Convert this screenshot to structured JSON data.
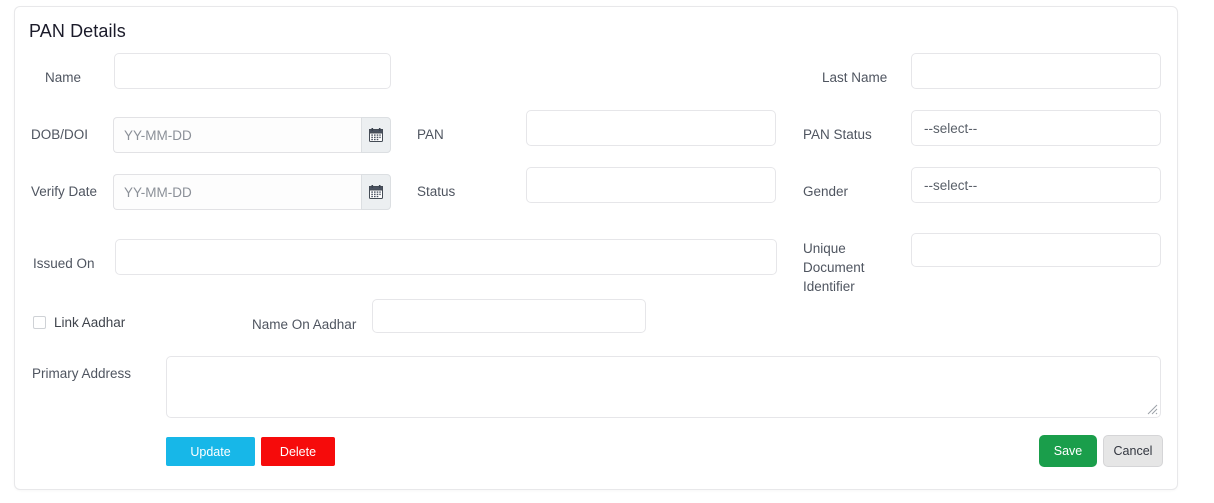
{
  "card": {
    "title": "PAN Details"
  },
  "fields": {
    "name": {
      "label": "Name",
      "value": "",
      "placeholder": ""
    },
    "last_name": {
      "label": "Last Name",
      "value": "",
      "placeholder": ""
    },
    "dob_doi": {
      "label": "DOB/DOI",
      "value": "",
      "placeholder": "YY-MM-DD",
      "icon": "calendar-icon"
    },
    "pan": {
      "label": "PAN",
      "value": "",
      "placeholder": ""
    },
    "pan_status": {
      "label": "PAN Status",
      "selected": "--select--"
    },
    "verify_date": {
      "label": "Verify Date",
      "value": "",
      "placeholder": "YY-MM-DD",
      "icon": "calendar-icon"
    },
    "status": {
      "label": "Status",
      "value": "",
      "placeholder": ""
    },
    "gender": {
      "label": "Gender",
      "selected": "--select--"
    },
    "issued_on": {
      "label": "Issued On",
      "value": "",
      "placeholder": ""
    },
    "unique_document_identifier": {
      "label": "Unique Document Identifier",
      "value": "",
      "placeholder": ""
    },
    "link_aadhar": {
      "label": "Link Aadhar",
      "checked": false
    },
    "name_on_aadhar": {
      "label": "Name On Aadhar",
      "value": "",
      "placeholder": ""
    },
    "primary_address": {
      "label": "Primary Address",
      "value": "",
      "placeholder": ""
    }
  },
  "buttons": {
    "update": {
      "label": "Update",
      "color": "#17b7e8"
    },
    "delete": {
      "label": "Delete",
      "color": "#f60b0b"
    },
    "save": {
      "label": "Save",
      "color": "#1a9e4b"
    },
    "cancel": {
      "label": "Cancel",
      "color": "#e6e6e6"
    }
  }
}
